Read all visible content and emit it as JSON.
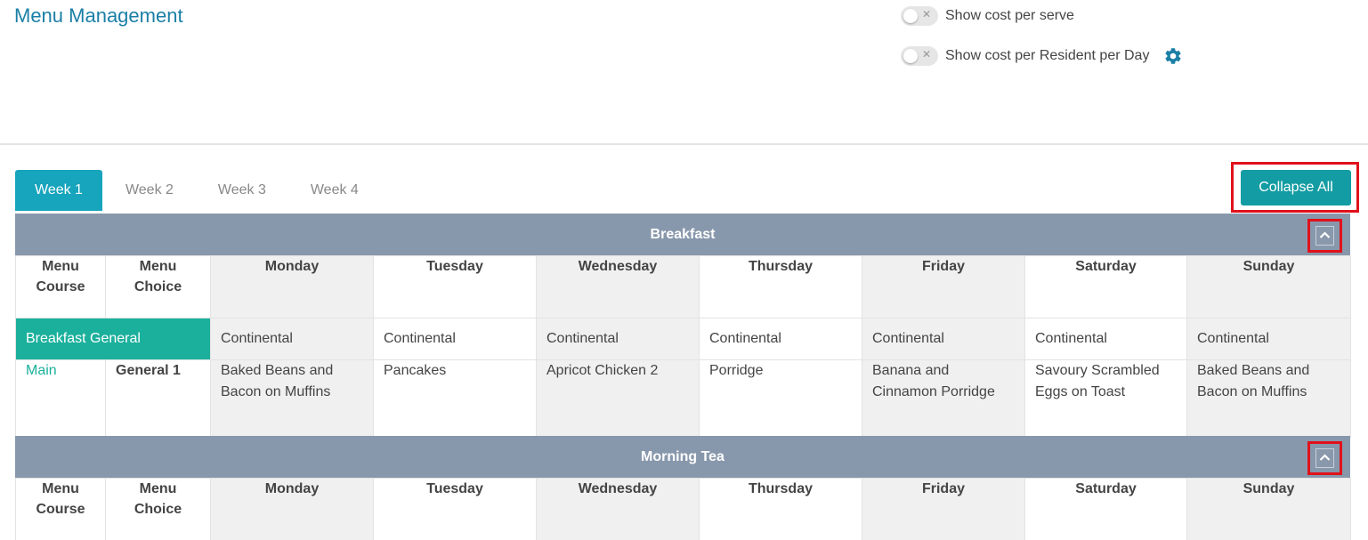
{
  "header": {
    "title": "Menu Management",
    "toggles": [
      {
        "label": "Show cost per serve",
        "on": false
      },
      {
        "label": "Show cost per Resident per Day",
        "on": false
      }
    ]
  },
  "tabs": [
    {
      "label": "Week 1",
      "active": true
    },
    {
      "label": "Week 2",
      "active": false
    },
    {
      "label": "Week 3",
      "active": false
    },
    {
      "label": "Week 4",
      "active": false
    }
  ],
  "collapse_all_label": "Collapse All",
  "columns": {
    "course": "Menu Course",
    "choice": "Menu Choice",
    "days": [
      "Monday",
      "Tuesday",
      "Wednesday",
      "Thursday",
      "Friday",
      "Saturday",
      "Sunday"
    ]
  },
  "sections": [
    {
      "title": "Breakfast",
      "general": {
        "label": "Breakfast General",
        "values": [
          "Continental",
          "Continental",
          "Continental",
          "Continental",
          "Continental",
          "Continental",
          "Continental"
        ]
      },
      "rows": [
        {
          "course": "Main",
          "choice": "General 1",
          "values": [
            "Baked Beans and Bacon on Muffins",
            "Pancakes",
            "Apricot Chicken 2",
            "Porridge",
            "Banana and Cinnamon Porridge",
            "Savoury Scrambled Eggs on Toast",
            "Baked Beans and Bacon on Muffins"
          ]
        }
      ]
    },
    {
      "title": "Morning Tea"
    }
  ],
  "colors": {
    "accent": "#17a4bd",
    "button": "#139ca3",
    "section_header": "#8898ac",
    "general_row": "#1bb09c",
    "highlight_box": "#e0111b"
  }
}
